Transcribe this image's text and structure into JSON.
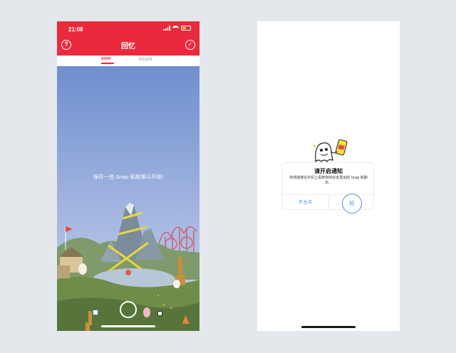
{
  "status_bar": {
    "time": "21:08"
  },
  "memories": {
    "title": "回忆",
    "tabs": [
      {
        "label": "SNAP",
        "active": true
      },
      {
        "label": "相机胶卷",
        "active": false
      }
    ],
    "empty_message": "保存一些 Snap 和故事以开始!"
  },
  "notification_prompt": {
    "title": "请开启通知",
    "message": "你将能够在手机上看到你的好友发出的 Snap 和聊天。",
    "deny_label": "不允许",
    "allow_label": "好"
  },
  "icons": {
    "help": "question-circle-icon",
    "done": "check-circle-icon",
    "shutter": "shutter-button-icon",
    "ghost_mascot": "ghost-mascot-icon"
  },
  "colors": {
    "brand_red": "#ea2a3c",
    "link_blue": "#4a90d9",
    "sky_top": "#6f8fcf",
    "sky_bottom": "#b9c8e9",
    "grass": "#6e8d49"
  }
}
